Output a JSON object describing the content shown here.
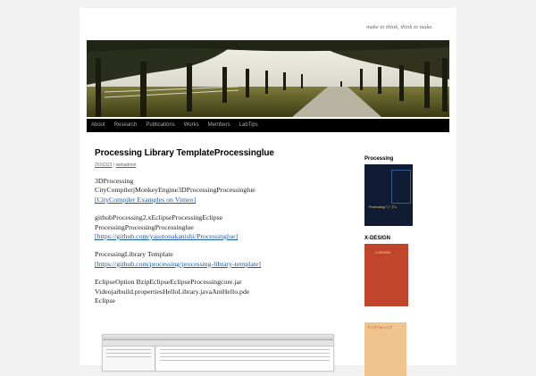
{
  "site": {
    "tagline": "make to think, think to make."
  },
  "menu": [
    {
      "label": "About"
    },
    {
      "label": "Research"
    },
    {
      "label": "Publications"
    },
    {
      "label": "Works"
    },
    {
      "label": "Members"
    },
    {
      "label": "LabTips"
    }
  ],
  "post": {
    "title": "Processing Library TemplateProcessinglue",
    "date": "2016323",
    "author": "webadmin",
    "paragraphs": [
      {
        "lines": [
          "3DProcessing",
          "CityCompilerjMonkeyEngine3DProcessingProcessinglue"
        ],
        "link": "[CityCompiler Examples on Vimeo]"
      },
      {
        "lines": [
          "githubProcessing2.xEclipseProcessingEclipse",
          "ProcessingProcessingProcessinglue"
        ],
        "link": "[https://github.com/yasutonakanishi/Processinglue]"
      },
      {
        "lines": [
          "ProcessingLibrary Template"
        ],
        "link": "[https://github.com/processing/processing-library-template]"
      },
      {
        "lines": [
          "EclipseOption BzipEclipseEclipseProcessingcore.jar",
          "Videojarbuild.propertiesHelloLibrary.javaAntHello.pde",
          "Eclipse"
        ],
        "link": null
      }
    ]
  },
  "sidebar": {
    "widget1_title": "Processing",
    "widget2_title": "X-DESIGN",
    "book1_text": "Processingバイブル",
    "book2_text": "X-DESIGN",
    "book3_text": "アイデアキャンプ"
  },
  "colors": {
    "nav_bg": "#000000",
    "link": "#1b5aa6",
    "page_bg": "#f1f1f1"
  }
}
